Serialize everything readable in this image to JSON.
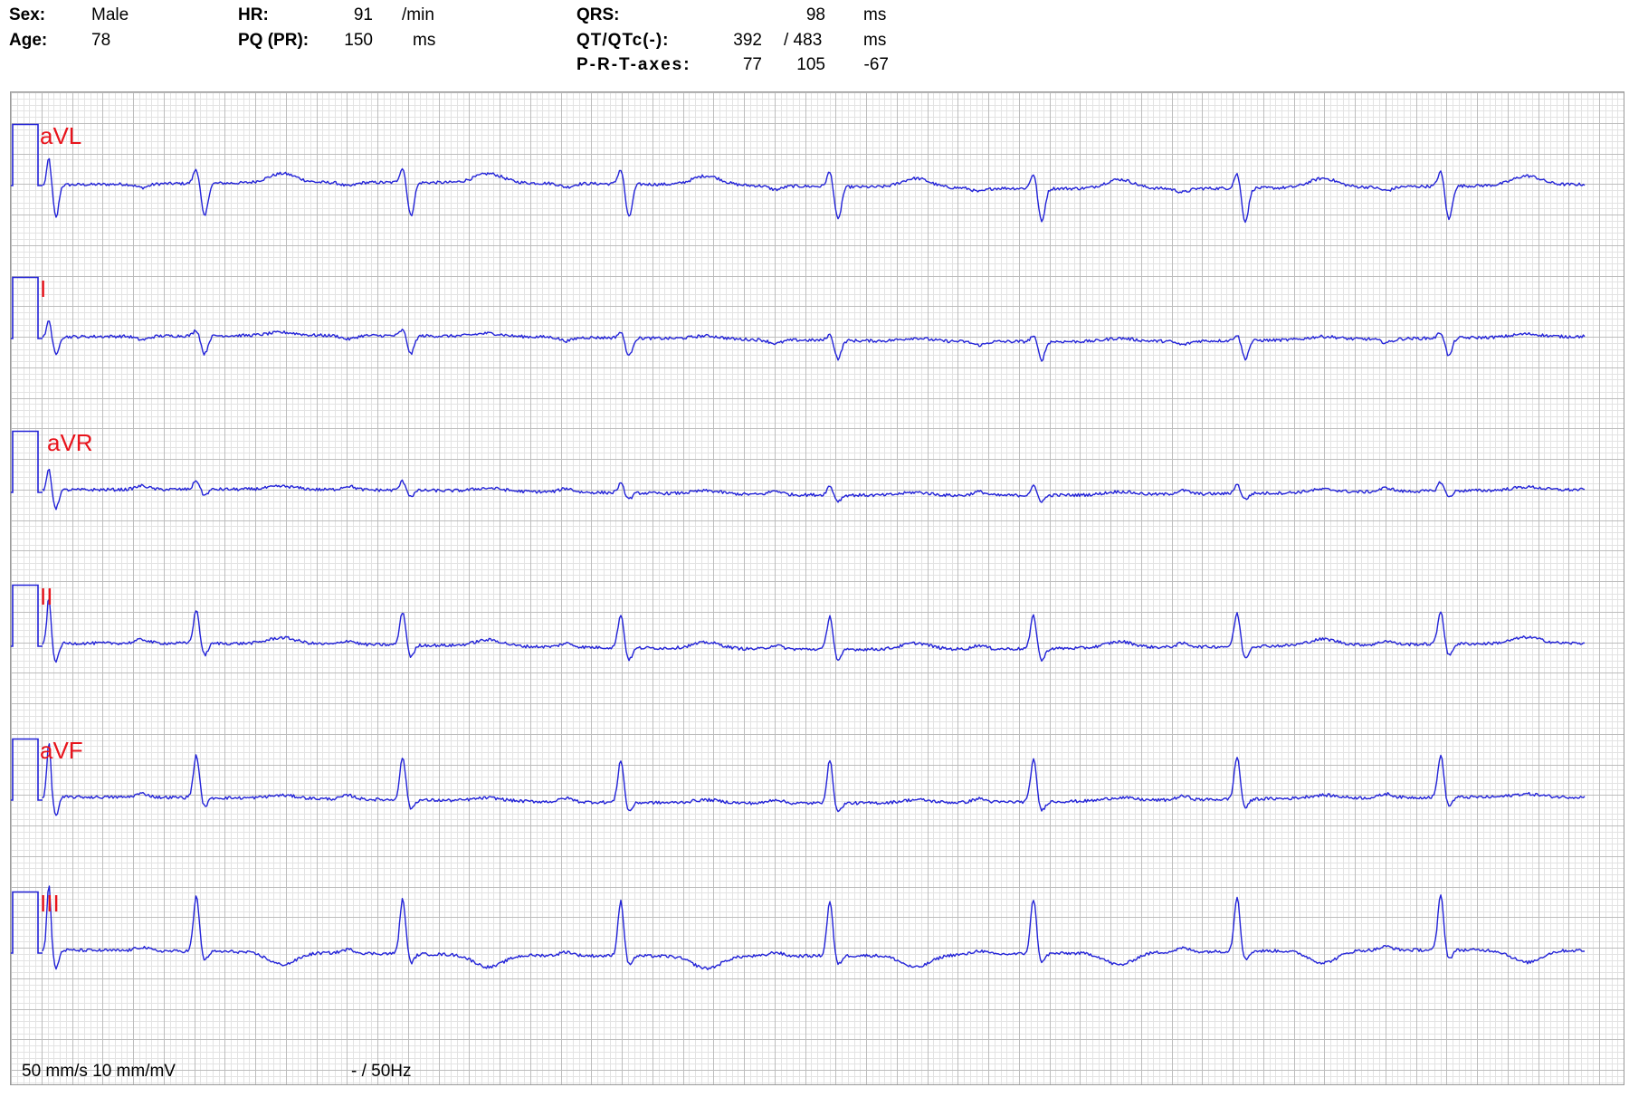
{
  "header": {
    "sex_label": "Sex:",
    "sex": "Male",
    "age_label": "Age:",
    "age": "78",
    "hr_label": "HR:",
    "hr": "91",
    "hr_unit": "/min",
    "pq_label": "PQ (PR):",
    "pq": "150",
    "pq_unit": "ms",
    "qrs_label": "QRS:",
    "qrs": "98",
    "qrs_unit": "ms",
    "qt_label": "QT/QTc(-):",
    "qt": "392",
    "qtc": "/ 483",
    "qt_unit": "ms",
    "axes_label": "P-R-T-axes:",
    "axis_p": "77",
    "axis_r": "105",
    "axis_t": "-67"
  },
  "footer": {
    "speed": "50 mm/s 10 mm/mV",
    "filter": "- / 50Hz"
  },
  "colors": {
    "trace": "#2323d8",
    "lead_label": "#e8141c",
    "grid_major": "#bdbdbd",
    "grid_minor": "#e3e3e3"
  },
  "chart_data": {
    "type": "line",
    "title": "",
    "leads": [
      {
        "name": "aVL",
        "qrs_polarity": "negative",
        "r_amp_mv": 0.25,
        "s_amp_mv": -0.55,
        "t_amp_mv": 0.15
      },
      {
        "name": "I",
        "qrs_polarity": "negative",
        "r_amp_mv": 0.1,
        "s_amp_mv": -0.3,
        "t_amp_mv": 0.05
      },
      {
        "name": "aVR",
        "qrs_polarity": "biphasic",
        "r_amp_mv": 0.15,
        "s_amp_mv": -0.1,
        "t_amp_mv": 0.05
      },
      {
        "name": "II",
        "qrs_polarity": "positive",
        "r_amp_mv": 0.55,
        "s_amp_mv": -0.2,
        "t_amp_mv": 0.1
      },
      {
        "name": "aVF",
        "qrs_polarity": "positive",
        "r_amp_mv": 0.7,
        "s_amp_mv": -0.15,
        "t_amp_mv": 0.05
      },
      {
        "name": "III",
        "qrs_polarity": "positive",
        "r_amp_mv": 0.9,
        "s_amp_mv": -0.15,
        "t_amp_mv": -0.2
      }
    ],
    "heart_rate_bpm": 91,
    "paper_speed_mm_s": 50,
    "gain_mm_mv": 10,
    "grid": true
  }
}
